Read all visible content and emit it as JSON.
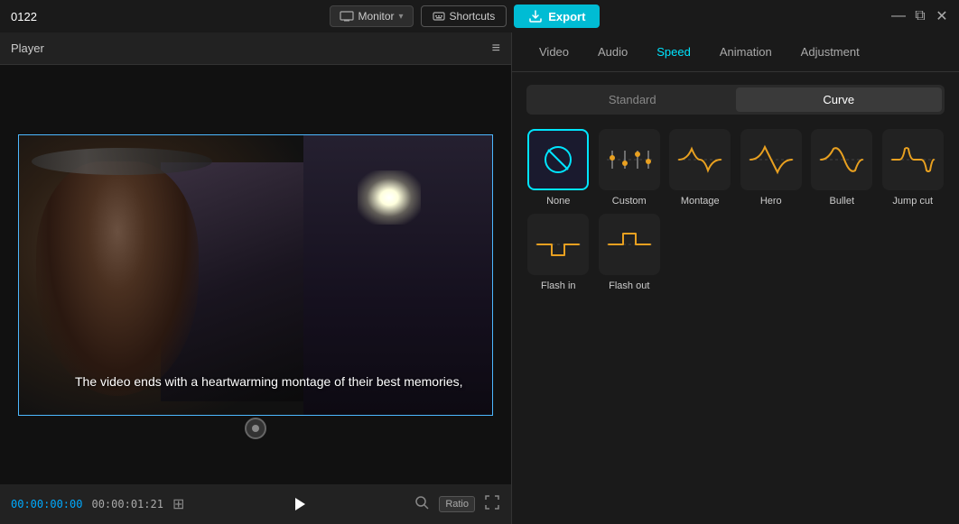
{
  "titleBar": {
    "appTitle": "0122",
    "monitorLabel": "Monitor",
    "shortcutsLabel": "Shortcuts",
    "exportLabel": "Export",
    "winBtnMinimize": "—",
    "winBtnRestore": "⧉",
    "winBtnClose": "✕"
  },
  "player": {
    "title": "Player",
    "menuIcon": "≡",
    "subtitle": "The video ends with a heartwarming montage of their best memories,",
    "timeCurrentLabel": "00:00:00:00",
    "timeTotalLabel": "00:00:01:21",
    "ratioLabel": "Ratio"
  },
  "rightPanel": {
    "tabs": [
      {
        "id": "video",
        "label": "Video"
      },
      {
        "id": "audio",
        "label": "Audio"
      },
      {
        "id": "speed",
        "label": "Speed"
      },
      {
        "id": "animation",
        "label": "Animation"
      },
      {
        "id": "adjustment",
        "label": "Adjustment"
      }
    ],
    "activeTab": "speed",
    "speedPanel": {
      "modes": [
        {
          "id": "standard",
          "label": "Standard"
        },
        {
          "id": "curve",
          "label": "Curve"
        }
      ],
      "activeMode": "curve",
      "presets": [
        {
          "id": "none",
          "label": "None",
          "selected": true,
          "iconType": "none"
        },
        {
          "id": "custom",
          "label": "Custom",
          "selected": false,
          "iconType": "custom"
        },
        {
          "id": "montage",
          "label": "Montage",
          "selected": false,
          "iconType": "montage"
        },
        {
          "id": "hero",
          "label": "Hero",
          "selected": false,
          "iconType": "hero"
        },
        {
          "id": "bullet",
          "label": "Bullet",
          "selected": false,
          "iconType": "bullet"
        },
        {
          "id": "jumpcut",
          "label": "Jump cut",
          "selected": false,
          "iconType": "jumpcut"
        },
        {
          "id": "flashin",
          "label": "Flash in",
          "selected": false,
          "iconType": "flashin"
        },
        {
          "id": "flashout",
          "label": "Flash out",
          "selected": false,
          "iconType": "flashout"
        }
      ]
    }
  }
}
